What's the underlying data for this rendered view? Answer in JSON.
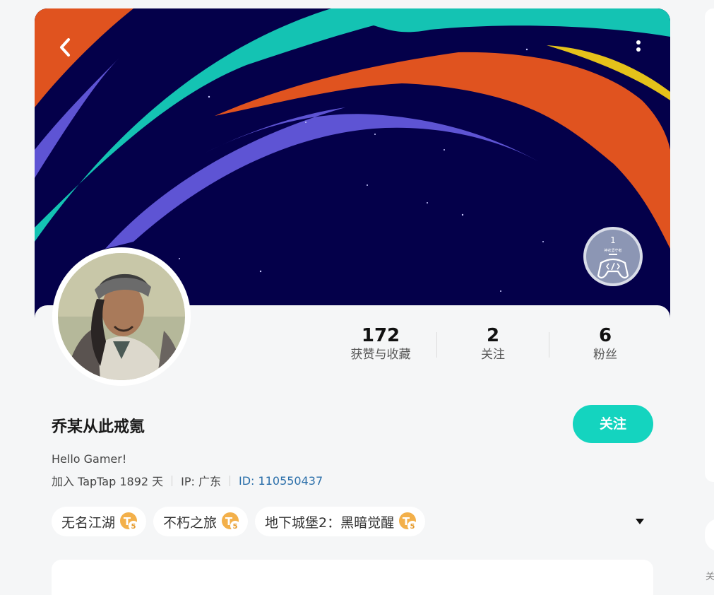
{
  "header": {
    "back_icon": "chevron-left-icon",
    "more_icon": "more-vertical-icon",
    "level_badge": {
      "level": "1",
      "caption": "神农坚守者"
    }
  },
  "profile": {
    "stats": [
      {
        "value": "172",
        "label": "获赞与收藏"
      },
      {
        "value": "2",
        "label": "关注"
      },
      {
        "value": "6",
        "label": "粉丝"
      }
    ],
    "username": "乔某从此戒氪",
    "follow_label": "关注",
    "bio": "Hello Gamer!",
    "joined": "加入 TapTap 1892 天",
    "ip": "IP: 广东",
    "user_id": "ID: 110550437",
    "game_tags": [
      {
        "name": "无名江湖",
        "level": "5"
      },
      {
        "name": "不朽之旅",
        "level": "5"
      },
      {
        "name": "地下城堡2：黑暗觉醒",
        "level": "5"
      }
    ]
  },
  "colors": {
    "accent": "#14d4bf",
    "banner_bg": "#04004a",
    "stripe_orange": "#e0531f",
    "stripe_teal": "#14c3b3",
    "stripe_purple": "#5e54d4",
    "stripe_yellow": "#e5c21a"
  }
}
